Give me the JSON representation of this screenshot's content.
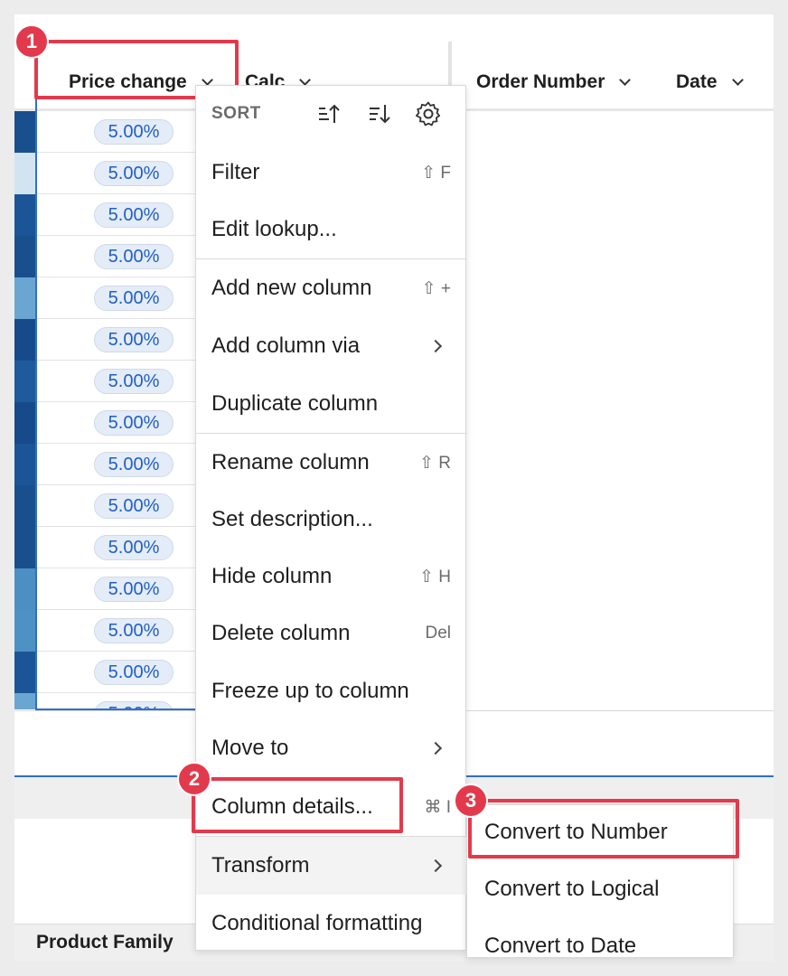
{
  "header": {
    "columns": [
      {
        "label": "Price change"
      },
      {
        "label": "Calc"
      },
      {
        "label": "Order Number"
      },
      {
        "label": "Date"
      }
    ]
  },
  "rows": {
    "values": [
      "5.00%",
      "5.00%",
      "5.00%",
      "5.00%",
      "5.00%",
      "5.00%",
      "5.00%",
      "5.00%",
      "5.00%",
      "5.00%",
      "5.00%",
      "5.00%",
      "5.00%",
      "5.00%",
      "5.00%"
    ],
    "strip_colors": [
      "#1a4f8e",
      "#d2e3f1",
      "#1c5597",
      "#1a4f8e",
      "#6aa6d1",
      "#174a8a",
      "#1f5a9c",
      "#174a8a",
      "#1c5597",
      "#1a4f8e",
      "#1a4f8e",
      "#4b8fc3",
      "#4e91c4",
      "#1c5597",
      "#6aa6d1"
    ]
  },
  "footer": {
    "label": "Product Family"
  },
  "menu": {
    "sort_label": "SORT",
    "items": [
      {
        "label": "Filter",
        "shortcut": "⇧ F"
      },
      {
        "label": "Edit lookup..."
      },
      {
        "label": "Add new column",
        "shortcut": "⇧ +"
      },
      {
        "label": "Add column via"
      },
      {
        "label": "Duplicate column"
      },
      {
        "label": "Rename column",
        "shortcut": "⇧ R"
      },
      {
        "label": "Set description..."
      },
      {
        "label": "Hide column",
        "shortcut": "⇧ H"
      },
      {
        "label": "Delete column",
        "shortcut": "Del"
      },
      {
        "label": "Freeze up to column"
      },
      {
        "label": "Move to"
      },
      {
        "label": "Column details...",
        "shortcut": "⌘ I"
      },
      {
        "label": "Transform"
      },
      {
        "label": "Conditional formatting"
      }
    ]
  },
  "submenu": {
    "items": [
      {
        "label": "Convert to Number"
      },
      {
        "label": "Convert to Logical"
      },
      {
        "label": "Convert to Date"
      }
    ]
  },
  "badges": [
    "1",
    "2",
    "3"
  ],
  "colors": {
    "highlight": "#e23a4c",
    "accent": "#2f6fce",
    "pill_text": "#1f5fc4"
  }
}
